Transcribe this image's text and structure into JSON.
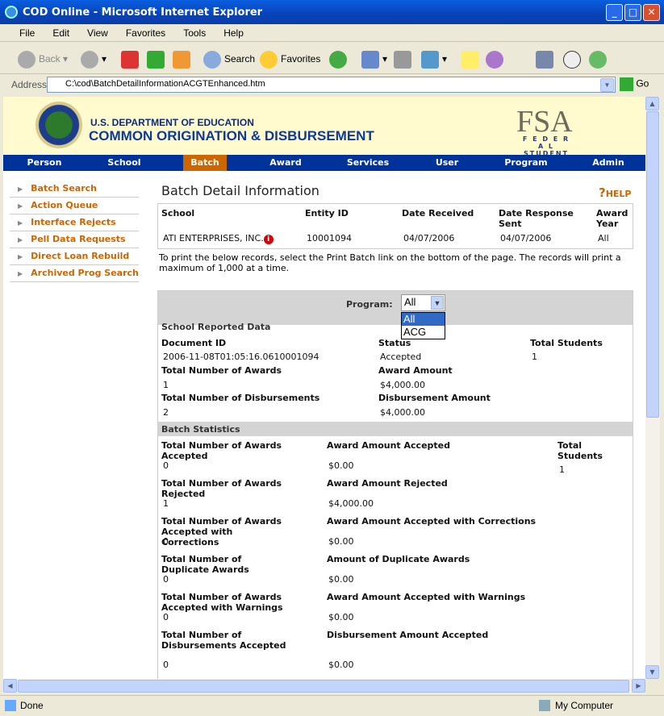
{
  "window": {
    "title": "COD Online - Microsoft Internet Explorer"
  },
  "menu": [
    "File",
    "Edit",
    "View",
    "Favorites",
    "Tools",
    "Help"
  ],
  "toolbar": {
    "back": "Back",
    "search": "Search",
    "favorites": "Favorites"
  },
  "address": {
    "label": "Address",
    "url": "C:\\cod\\BatchDetailInformationACGTEnhanced.htm",
    "go": "Go"
  },
  "banner": {
    "dept": "U.S. DEPARTMENT OF EDUCATION",
    "system": "COMMON ORIGINATION & DISBURSEMENT",
    "fsa": "FSA",
    "fsa_sub1": "F E D E R A L",
    "fsa_sub2": "STUDENT AID"
  },
  "nav": [
    "Person",
    "School",
    "Batch",
    "Award",
    "Services",
    "User",
    "Program",
    "Admin"
  ],
  "nav_active": "Batch",
  "sidebar": [
    "Batch Search",
    "Action Queue",
    "Interface Rejects",
    "Pell Data Requests",
    "Direct Loan Rebuild",
    "Archived Prog Search"
  ],
  "page": {
    "title": "Batch Detail Information",
    "help": "HELP",
    "school_headers": [
      "School",
      "Entity ID",
      "Date Received",
      "Date Response Sent",
      "Award Year"
    ],
    "school_values": [
      "ATI ENTERPRISES, INC.",
      "10001094",
      "04/07/2006",
      "04/07/2006",
      "All"
    ],
    "note": "To print the below records, select the Print Batch link on the bottom of the page. The records will print a maximum of 1,000 at a time."
  },
  "program": {
    "label": "Program:",
    "selected": "All",
    "options": [
      "All",
      "ACG"
    ]
  },
  "school_reported": {
    "title": "School Reported Data",
    "doc_id_label": "Document ID",
    "doc_id": "2006-11-08T01:05:16.0610001094",
    "status_label": "Status",
    "status": "Accepted",
    "total_students_label": "Total Students",
    "total_students": "1",
    "awards_label": "Total Number of Awards",
    "awards": "1",
    "award_amount_label": "Award Amount",
    "award_amount": "$4,000.00",
    "disb_label": "Total Number of Disbursements",
    "disb": "2",
    "disb_amount_label": "Disbursement Amount",
    "disb_amount": "$4,000.00"
  },
  "batch_stats": {
    "title": "Batch Statistics",
    "total_students_label": "Total Students",
    "total_students": "1",
    "rows": [
      {
        "l1": "Total Number of Awards Accepted",
        "v1": "0",
        "l2": "Award Amount Accepted",
        "v2": "$0.00"
      },
      {
        "l1": "Total Number of Awards Rejected",
        "v1": "1",
        "l2": "Award Amount Rejected",
        "v2": "$4,000.00"
      },
      {
        "l1": "Total Number of Awards Accepted with Corrections",
        "v1": "0",
        "l2": "Award Amount Accepted with Corrections",
        "v2": "$0.00"
      },
      {
        "l1": "Total Number of Duplicate Awards",
        "v1": "0",
        "l2": "Amount of Duplicate Awards",
        "v2": "$0.00"
      },
      {
        "l1": "Total Number of Awards Accepted with Warnings",
        "v1": "0",
        "l2": "Award Amount Accepted with Warnings",
        "v2": "$0.00"
      },
      {
        "l1": "Total Number of Disbursements Accepted",
        "v1": "0",
        "l2": "Disbursement Amount Accepted",
        "v2": "$0.00"
      }
    ]
  },
  "status": {
    "left": "Done",
    "zone": "My Computer"
  },
  "colors": {
    "nav": "#003399",
    "active": "#cc6600",
    "link": "#cc6600",
    "banner": "#fffbcf"
  }
}
